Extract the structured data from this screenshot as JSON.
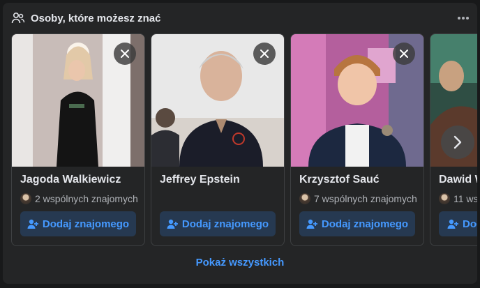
{
  "header": {
    "title": "Osoby, które możesz znać",
    "icon": "people-icon"
  },
  "more_icon": "ellipsis-icon",
  "cards": [
    {
      "name": "Jagoda Walkiewicz",
      "mutual": "2 wspólnych znajomych",
      "button": "Dodaj znajomego"
    },
    {
      "name": "Jeffrey Epstein",
      "mutual": "",
      "button": "Dodaj znajomego"
    },
    {
      "name": "Krzysztof Sauć",
      "mutual": "7 wspólnych znajomych",
      "button": "Dodaj znajomego"
    },
    {
      "name": "Dawid W",
      "mutual": "11 wsp",
      "button": "Dodaj"
    }
  ],
  "footer": {
    "show_all": "Pokaż wszystkich"
  },
  "colors": {
    "accent": "#4599ff",
    "button_bg": "#263951",
    "panel_bg": "#242526"
  }
}
